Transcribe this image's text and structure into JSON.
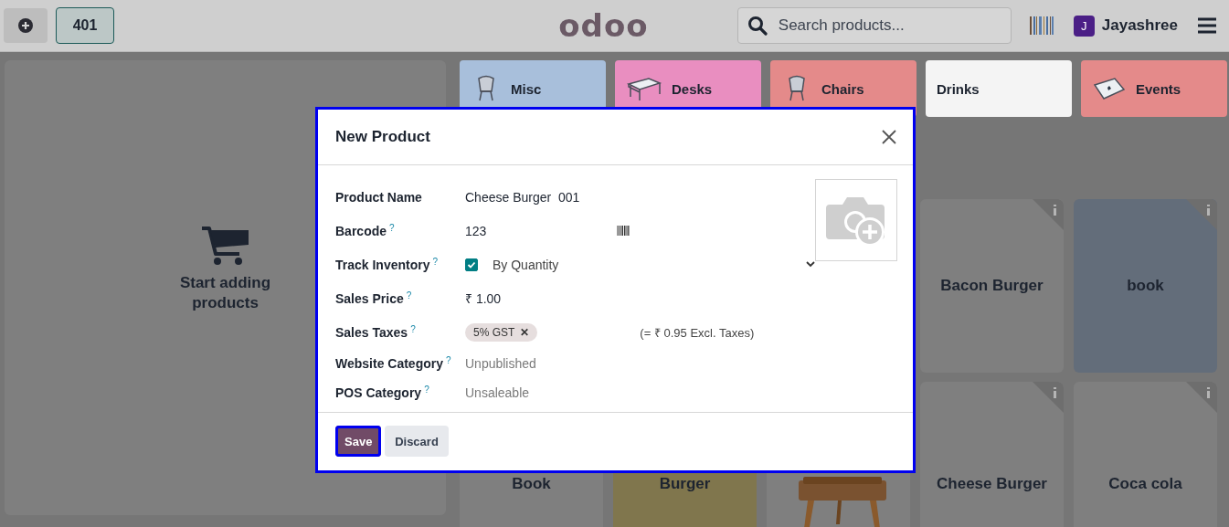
{
  "topbar": {
    "order_number": "401",
    "logo": "odoo",
    "search": {
      "placeholder": "Search products..."
    },
    "user": {
      "initial": "J",
      "name": "Jayashree"
    }
  },
  "empty_cart": {
    "message": "Start adding products"
  },
  "categories": [
    {
      "label": "Misc",
      "color": "#a8bfdb"
    },
    {
      "label": "Desks",
      "color": "#e98ec0"
    },
    {
      "label": "Chairs",
      "color": "#e48a8a"
    },
    {
      "label": "Drinks",
      "color": "#f4f4f4"
    },
    {
      "label": "Events",
      "color": "#e48a8a"
    }
  ],
  "products_row_1": [
    {
      "kind": "text",
      "name": "Bacon Burger",
      "color": "#7f7f7f"
    },
    {
      "kind": "text",
      "name": "book",
      "color": "#636d7a"
    }
  ],
  "products_row_2": [
    {
      "kind": "text",
      "name": "Book",
      "color": "#7f7f7f"
    },
    {
      "kind": "text",
      "name": "Burger",
      "color": "#80764d"
    },
    {
      "kind": "picture",
      "color": "#7f7f7f"
    },
    {
      "kind": "text",
      "name": "Cheese Burger",
      "color": "#7f7f7f"
    },
    {
      "kind": "text",
      "name": "Coca cola",
      "color": "#7f7f7f"
    }
  ],
  "dialog": {
    "title": "New Product",
    "fields": [
      {
        "kind": "text",
        "label": "Product Name",
        "value": "Cheese Burger  001"
      },
      {
        "kind": "barcode",
        "label": "Barcode",
        "help": "?",
        "value": "123"
      },
      {
        "kind": "checkbox_select",
        "label": "Track Inventory",
        "help": "?",
        "checked": true,
        "value": "By Quantity"
      },
      {
        "kind": "text",
        "label": "Sales Price",
        "help": "?",
        "value": "₹ 1.00"
      },
      {
        "kind": "tags",
        "label": "Sales Taxes",
        "help": "?",
        "tags": [
          {
            "label": "5% GST",
            "remove": "✕"
          }
        ],
        "note": "(= ₹ 0.95 Excl. Taxes)"
      },
      {
        "kind": "placeholder",
        "label": "Website Category",
        "help": "?",
        "placeholder": "Unpublished"
      },
      {
        "kind": "placeholder",
        "label": "POS Category",
        "help": "?",
        "placeholder": "Unsaleable"
      }
    ],
    "buttons": [
      {
        "label": "Save",
        "kind": "primary"
      },
      {
        "label": "Discard",
        "kind": "secondary"
      }
    ]
  }
}
